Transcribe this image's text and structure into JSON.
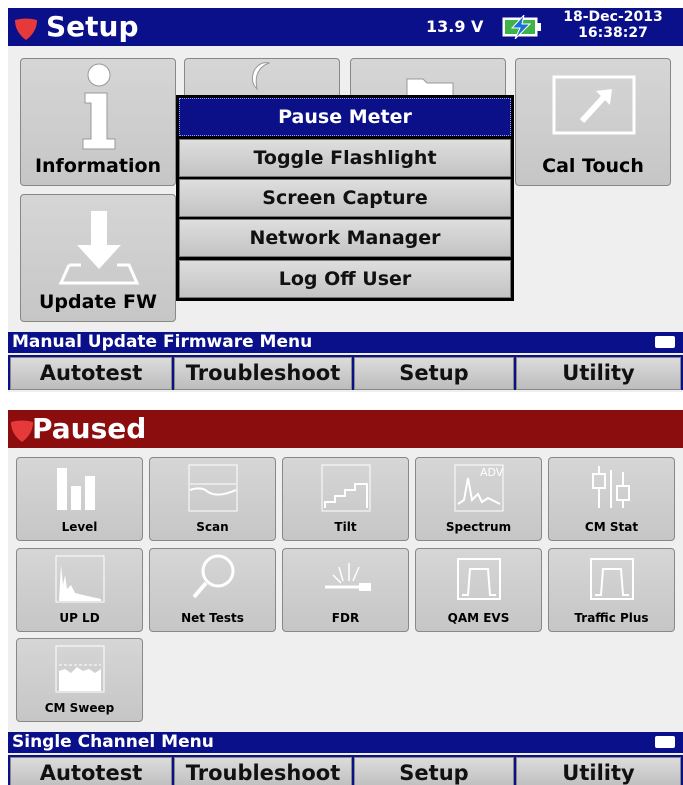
{
  "setup": {
    "title": "Setup",
    "voltage": "13.9 V",
    "date": "18-Dec-2013",
    "time": "16:38:27",
    "tiles": {
      "information": "Information",
      "cal_touch": "Cal Touch",
      "update_fw": "Update FW"
    },
    "menu": [
      "Pause Meter",
      "Toggle Flashlight",
      "Screen Capture",
      "Network Manager",
      "Log Off User"
    ],
    "status": "Manual Update Firmware Menu",
    "softkeys": [
      "Autotest",
      "Troubleshoot",
      "Setup",
      "Utility"
    ]
  },
  "paused": {
    "title": "Paused",
    "tiles": [
      "Level",
      "Scan",
      "Tilt",
      "Spectrum",
      "CM Stat",
      "UP LD",
      "Net Tests",
      "FDR",
      "QAM EVS",
      "Traffic Plus",
      "CM Sweep"
    ],
    "spectrum_badge": "ADV",
    "status": "Single Channel Menu",
    "softkeys": [
      "Autotest",
      "Troubleshoot",
      "Setup",
      "Utility"
    ]
  },
  "colors": {
    "titlebar_blue": "#0a0f8a",
    "paused_red": "#8b0d0d",
    "selected_menu": "#0b0f88",
    "battery_bolt": "#1a6fd8"
  }
}
